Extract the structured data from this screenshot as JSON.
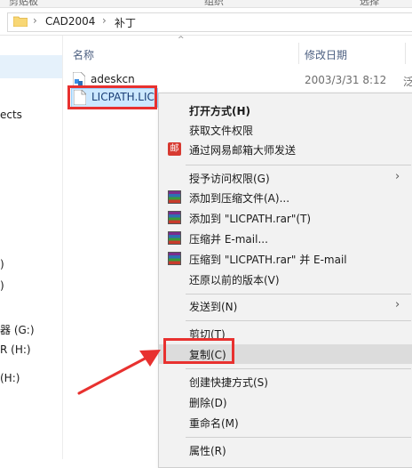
{
  "top_strip": {
    "left_text": "剪贴板",
    "mid_text": "组织",
    "right_text": "选择"
  },
  "address": {
    "crumbs": [
      "CAD2004",
      "补丁"
    ]
  },
  "nav": {
    "items": [
      "ects",
      ")",
      ")",
      "器 (G:)",
      "R (H:)",
      "(H:)"
    ]
  },
  "columns": {
    "name": "名称",
    "date": "修改日期"
  },
  "files": [
    {
      "name": "adeskcn",
      "date": "2003/3/31 8:12",
      "extra": "泛"
    },
    {
      "name": "LICPATH.LIC",
      "date": "",
      "extra": ""
    }
  ],
  "context_menu": {
    "items": [
      {
        "label": "打开方式(H)",
        "bold": true
      },
      {
        "label": "获取文件权限"
      },
      {
        "label": "通过网易邮箱大师发送",
        "icon": "mail-icon",
        "icon_text": "邮"
      },
      {
        "label": "授予访问权限(G)",
        "submenu": true
      },
      {
        "label": "添加到压缩文件(A)...",
        "icon": "winrar-icon"
      },
      {
        "label": "添加到 \"LICPATH.rar\"(T)",
        "icon": "winrar-icon"
      },
      {
        "label": "压缩并 E-mail...",
        "icon": "winrar-icon"
      },
      {
        "label": "压缩到 \"LICPATH.rar\" 并 E-mail",
        "icon": "winrar-icon"
      },
      {
        "label": "还原以前的版本(V)"
      },
      {
        "label": "发送到(N)",
        "submenu": true
      },
      {
        "label": "剪切(T)"
      },
      {
        "label": "复制(C)",
        "highlighted": true
      },
      {
        "label": "创建快捷方式(S)"
      },
      {
        "label": "删除(D)"
      },
      {
        "label": "重命名(M)"
      },
      {
        "label": "属性(R)"
      }
    ],
    "submenu_arrow": "›"
  },
  "colors": {
    "annotation_red": "#e8312f",
    "selection_blue": "#cce8ff",
    "menu_bg": "#f2f2f2"
  }
}
